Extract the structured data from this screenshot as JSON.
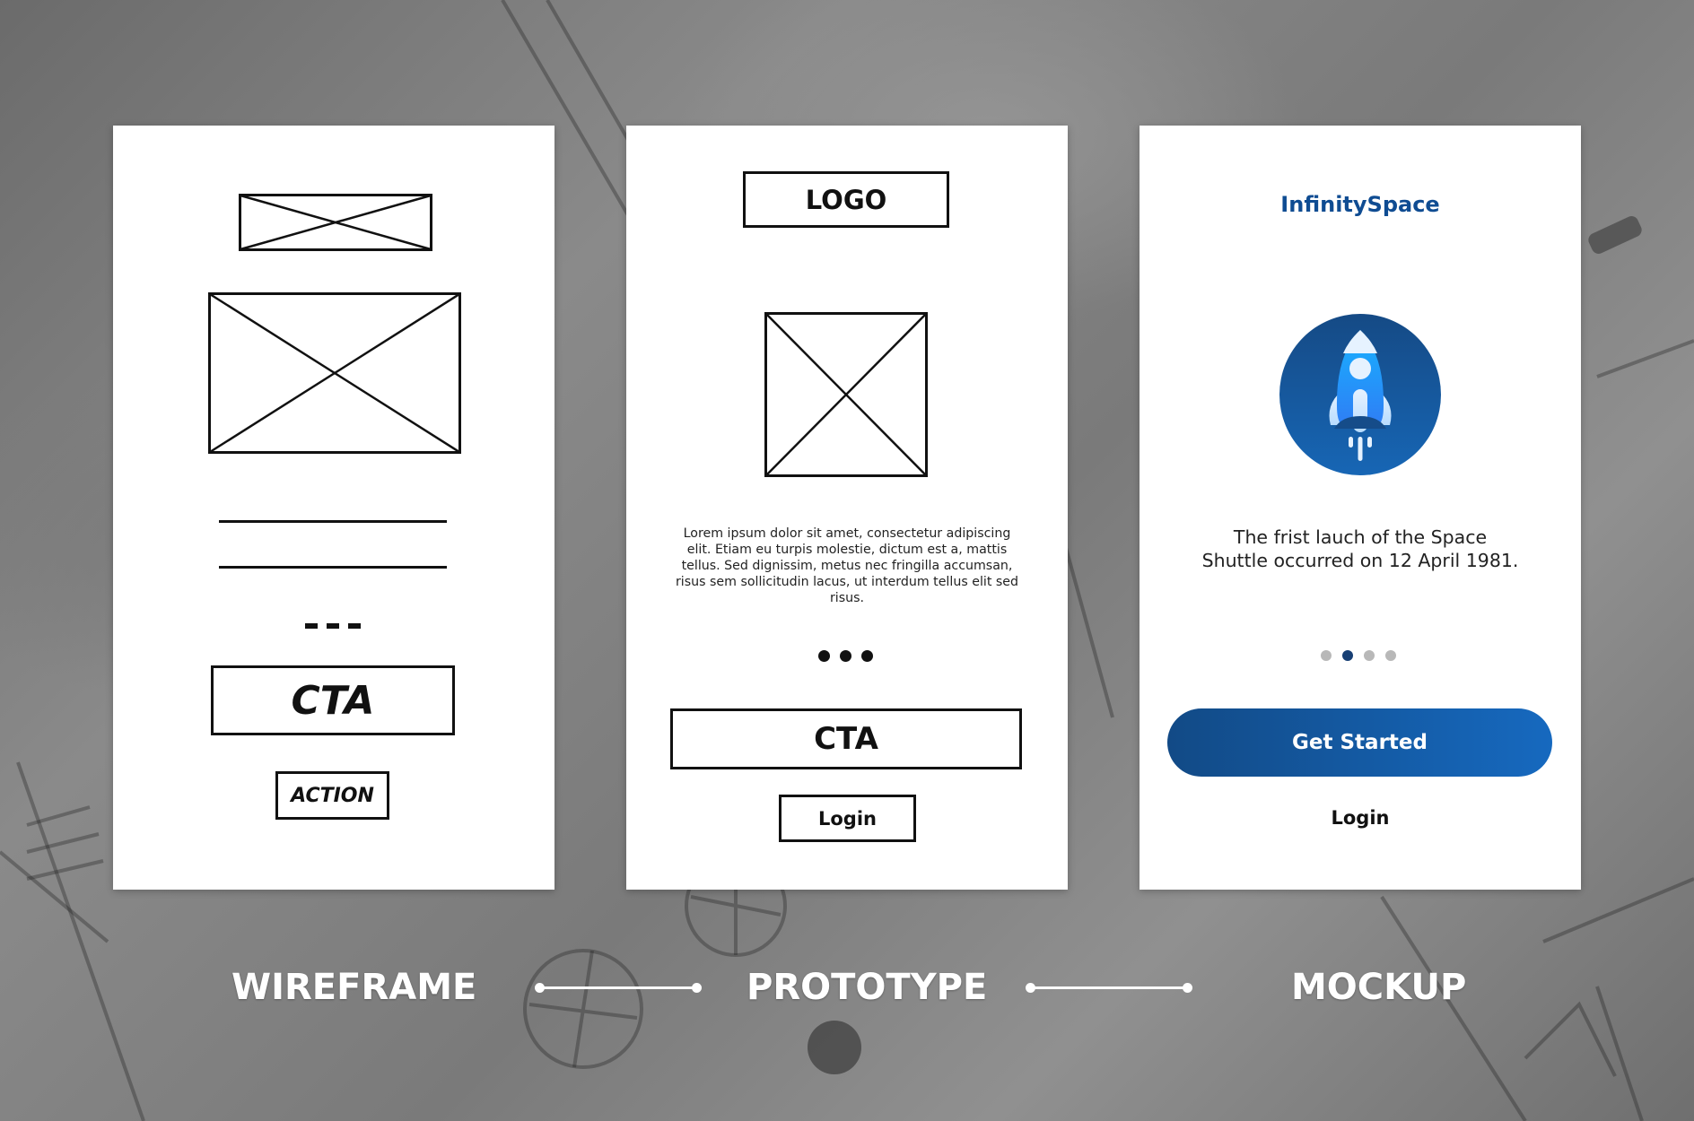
{
  "wireframe": {
    "cta_label": "CTA",
    "action_label": "ACTION"
  },
  "prototype": {
    "logo_label": "LOGO",
    "body_text": "Lorem ipsum dolor sit amet, consectetur adipiscing elit. Etiam eu turpis molestie, dictum est a, mattis tellus. Sed dignissim, metus nec fringilla accumsan, risus sem sollicitudin lacus, ut interdum tellus elit sed risus.",
    "cta_label": "CTA",
    "login_label": "Login"
  },
  "mockup": {
    "brand_name": "InfinitySpace",
    "hero_icon": "rocket-icon",
    "caption_line1": "The frist lauch of the Space",
    "caption_line2": "Shuttle occurred on 12 April 1981.",
    "pagination": {
      "total": 4,
      "active_index": 1
    },
    "get_started_label": "Get Started",
    "login_label": "Login",
    "colors": {
      "brand": "#0f4c92",
      "button_start": "#124a86",
      "button_end": "#1669bf",
      "dot_active": "#173f74",
      "dot_inactive": "#b8b8b8"
    }
  },
  "stages": {
    "wireframe": "WIREFRAME",
    "prototype": "PROTOTYPE",
    "mockup": "MOCKUP"
  }
}
